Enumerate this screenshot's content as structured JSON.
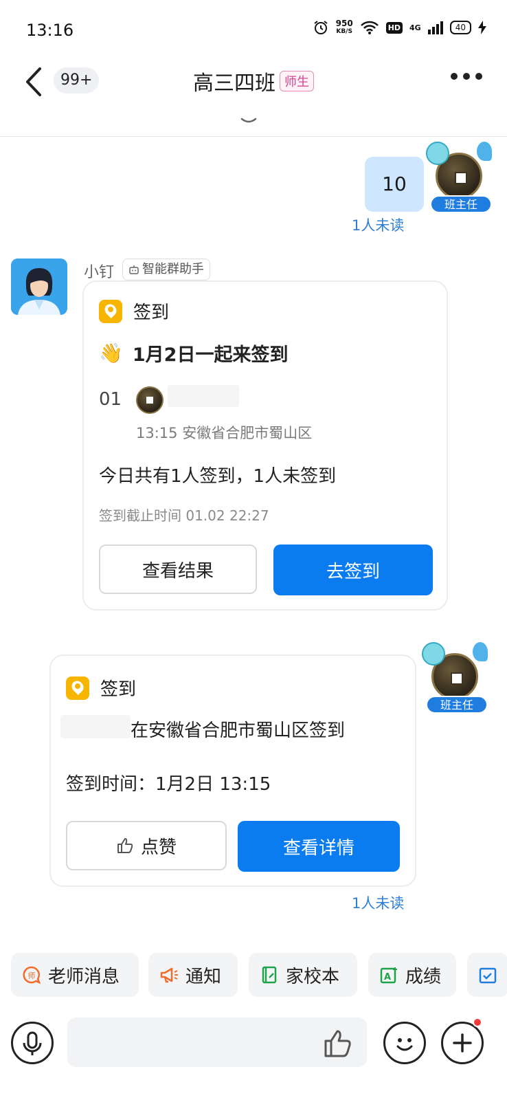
{
  "status_bar": {
    "time": "13:16",
    "speed_value": "950",
    "speed_unit": "KB/S",
    "hd": "HD",
    "network": "4G",
    "battery": "40"
  },
  "header": {
    "unread_count": "99+",
    "title": "高三四班",
    "title_tag": "师生"
  },
  "messages": {
    "first": {
      "text": "10",
      "sender_role": "班主任",
      "read_status": "1人未读"
    },
    "bot": {
      "name": "小钉",
      "tag": "智能群助手",
      "card": {
        "head_label": "签到",
        "subtitle": "1月2日一起来签到",
        "entry_num": "01",
        "entry_meta": "13:15 安徽省合肥市蜀山区",
        "summary": "今日共有1人签到，1人未签到",
        "deadline": "签到截止时间 01.02 22:27",
        "btn_view_result": "查看结果",
        "btn_checkin": "去签到"
      }
    },
    "second": {
      "sender_role": "班主任",
      "head_label": "签到",
      "location_text": "在安徽省合肥市蜀山区签到",
      "time_text": "签到时间：1月2日 13:15",
      "btn_like": "点赞",
      "btn_detail": "查看详情",
      "read_status": "1人未读"
    }
  },
  "quick_bar": {
    "items": [
      {
        "label": "老师消息",
        "icon": "teacher-message-icon",
        "color": "#f26b2a"
      },
      {
        "label": "通知",
        "icon": "megaphone-icon",
        "color": "#f26b2a"
      },
      {
        "label": "家校本",
        "icon": "notebook-icon",
        "color": "#1fa34a"
      },
      {
        "label": "成绩",
        "icon": "grade-icon",
        "color": "#1fa34a"
      }
    ]
  },
  "colors": {
    "accent": "#0a7cf0",
    "read_status": "#2d7fd3",
    "checkin_icon": "#f7b500",
    "role_badge": "#1f7de0"
  }
}
